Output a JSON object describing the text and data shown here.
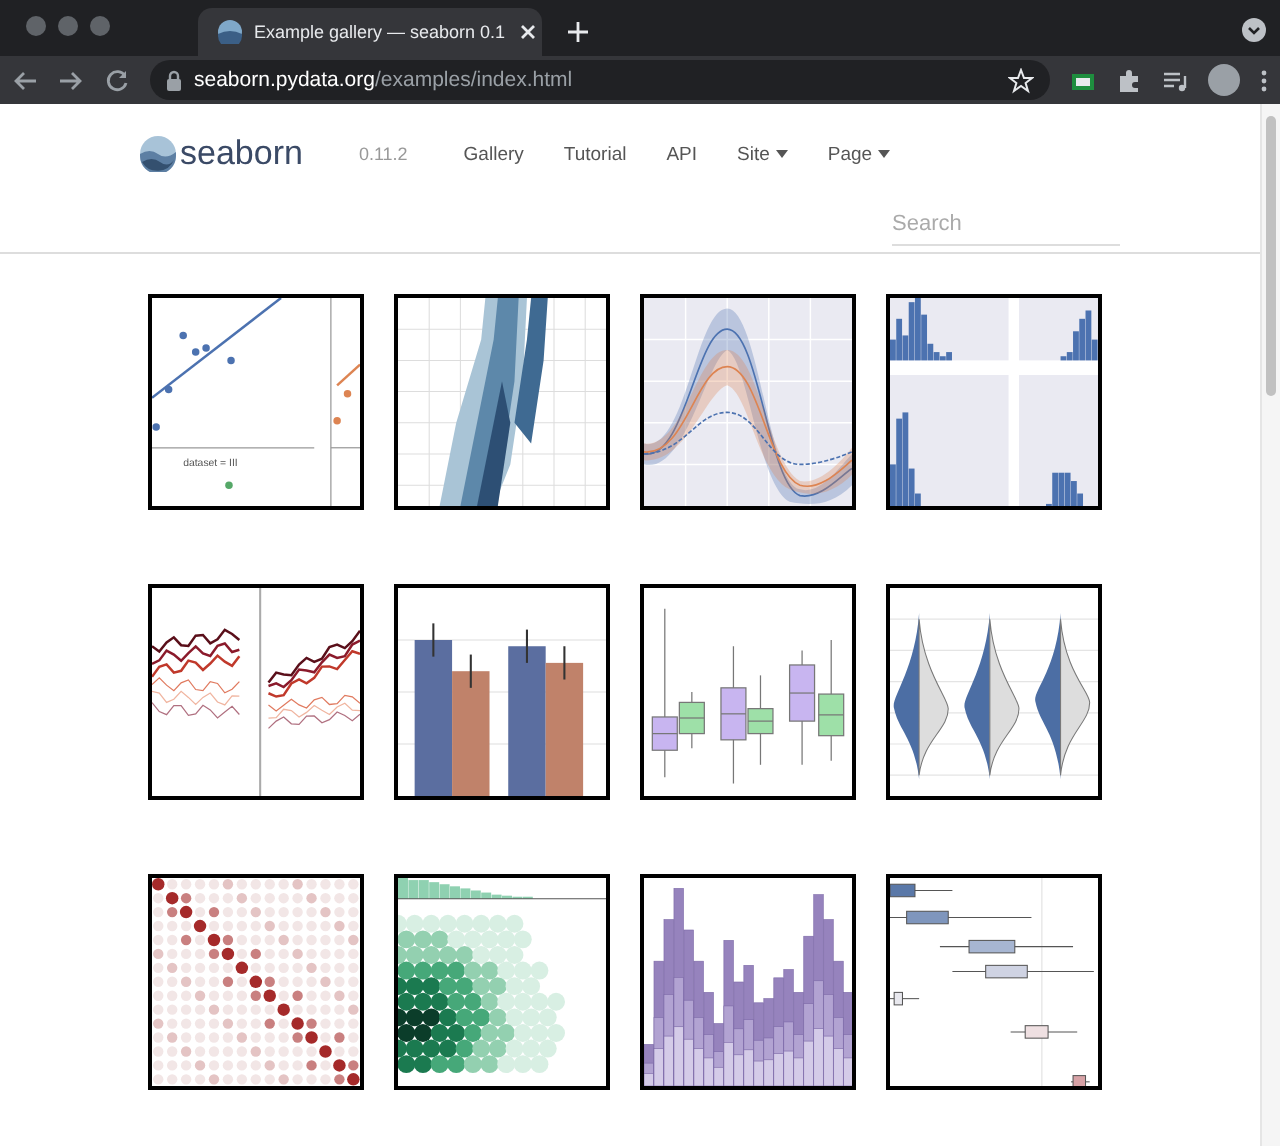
{
  "browser": {
    "tab_title": "Example gallery — seaborn 0.1",
    "url": {
      "host": "seaborn.pydata.org",
      "path": "/examples/index.html"
    }
  },
  "navbar": {
    "brand": "seaborn",
    "version": "0.11.2",
    "links": [
      {
        "label": "Gallery",
        "dropdown": false
      },
      {
        "label": "Tutorial",
        "dropdown": false
      },
      {
        "label": "API",
        "dropdown": false
      },
      {
        "label": "Site",
        "dropdown": true
      },
      {
        "label": "Page",
        "dropdown": true
      }
    ]
  },
  "search": {
    "placeholder": "Search"
  },
  "gallery": [
    {
      "kind": "regression",
      "label": "dataset = III"
    },
    {
      "kind": "density_scatter"
    },
    {
      "kind": "timeseries"
    },
    {
      "kind": "histogram_grid"
    },
    {
      "kind": "lines"
    },
    {
      "kind": "bars"
    },
    {
      "kind": "boxplot"
    },
    {
      "kind": "violin"
    },
    {
      "kind": "dot_matrix"
    },
    {
      "kind": "hexbin"
    },
    {
      "kind": "stacked_histogram"
    },
    {
      "kind": "hbox"
    }
  ]
}
